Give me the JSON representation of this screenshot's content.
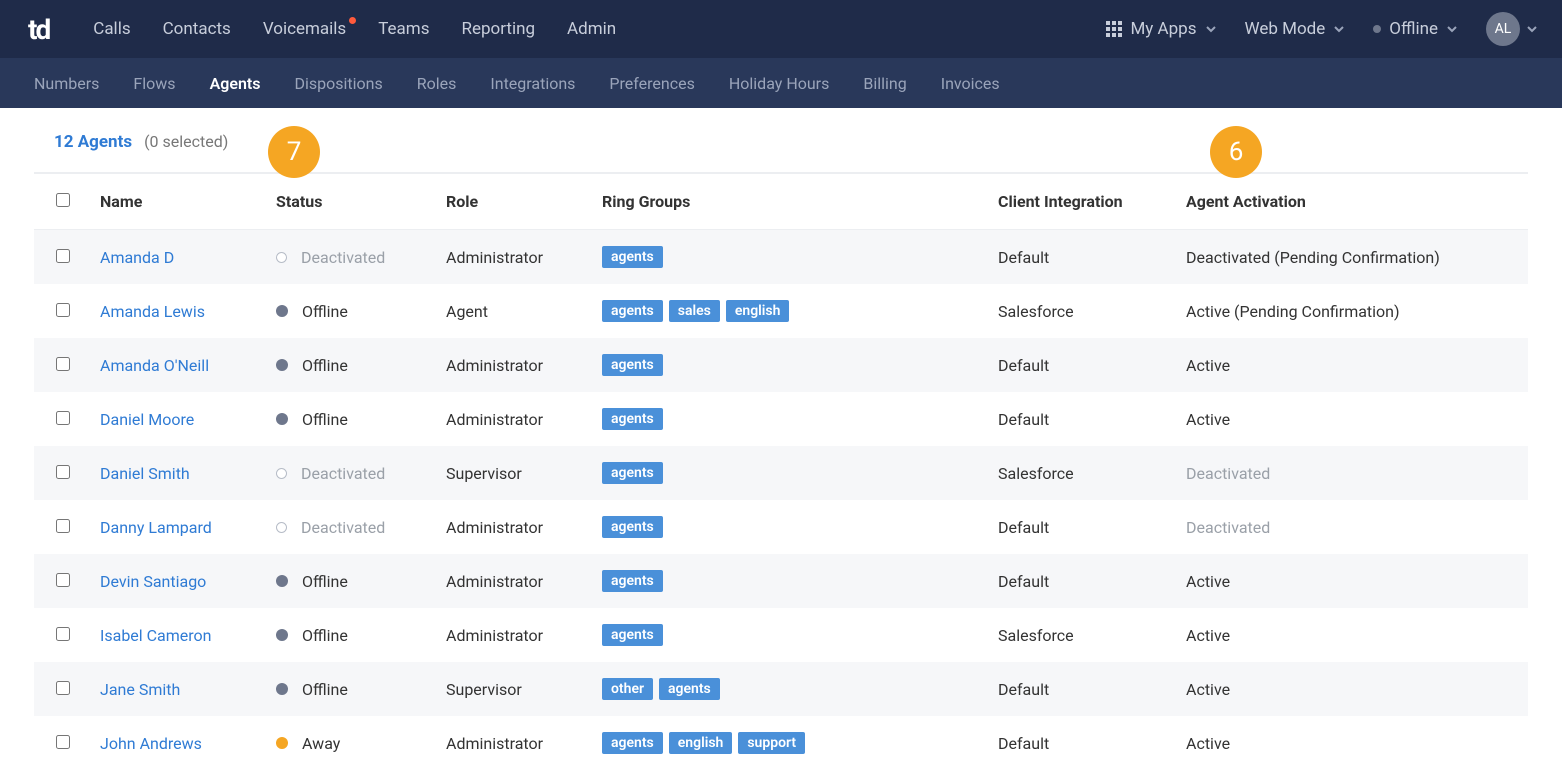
{
  "header": {
    "logo": "td",
    "nav": [
      "Calls",
      "Contacts",
      "Voicemails",
      "Teams",
      "Reporting",
      "Admin"
    ],
    "nav_notif_index": 2,
    "my_apps": "My Apps",
    "web_mode": "Web Mode",
    "presence": "Offline",
    "avatar_initials": "AL"
  },
  "subnav": {
    "items": [
      "Numbers",
      "Flows",
      "Agents",
      "Dispositions",
      "Roles",
      "Integrations",
      "Preferences",
      "Holiday Hours",
      "Billing",
      "Invoices"
    ],
    "active_index": 2
  },
  "list_header": {
    "count_text": "12 Agents",
    "selected_text": "(0 selected)"
  },
  "columns": {
    "name": "Name",
    "status": "Status",
    "role": "Role",
    "ring": "Ring Groups",
    "client": "Client Integration",
    "activation": "Agent Activation"
  },
  "badges": {
    "b7": "7",
    "b6": "6"
  },
  "rows": [
    {
      "name": "Amanda D",
      "status": "Deactivated",
      "status_kind": "deactivated",
      "role": "Administrator",
      "ring": [
        "agents"
      ],
      "client": "Default",
      "activation": "Deactivated (Pending Confirmation)",
      "act_muted": false
    },
    {
      "name": "Amanda Lewis",
      "status": "Offline",
      "status_kind": "offline",
      "role": "Agent",
      "ring": [
        "agents",
        "sales",
        "english"
      ],
      "client": "Salesforce",
      "activation": "Active (Pending Confirmation)",
      "act_muted": false
    },
    {
      "name": "Amanda O'Neill",
      "status": "Offline",
      "status_kind": "offline",
      "role": "Administrator",
      "ring": [
        "agents"
      ],
      "client": "Default",
      "activation": "Active",
      "act_muted": false
    },
    {
      "name": "Daniel Moore",
      "status": "Offline",
      "status_kind": "offline",
      "role": "Administrator",
      "ring": [
        "agents"
      ],
      "client": "Default",
      "activation": "Active",
      "act_muted": false
    },
    {
      "name": "Daniel Smith",
      "status": "Deactivated",
      "status_kind": "deactivated",
      "role": "Supervisor",
      "ring": [
        "agents"
      ],
      "client": "Salesforce",
      "activation": "Deactivated",
      "act_muted": true
    },
    {
      "name": "Danny Lampard",
      "status": "Deactivated",
      "status_kind": "deactivated",
      "role": "Administrator",
      "ring": [
        "agents"
      ],
      "client": "Default",
      "activation": "Deactivated",
      "act_muted": true
    },
    {
      "name": "Devin Santiago",
      "status": "Offline",
      "status_kind": "offline",
      "role": "Administrator",
      "ring": [
        "agents"
      ],
      "client": "Default",
      "activation": "Active",
      "act_muted": false
    },
    {
      "name": "Isabel Cameron",
      "status": "Offline",
      "status_kind": "offline",
      "role": "Administrator",
      "ring": [
        "agents"
      ],
      "client": "Salesforce",
      "activation": "Active",
      "act_muted": false
    },
    {
      "name": "Jane Smith",
      "status": "Offline",
      "status_kind": "offline",
      "role": "Supervisor",
      "ring": [
        "other",
        "agents"
      ],
      "client": "Default",
      "activation": "Active",
      "act_muted": false
    },
    {
      "name": "John Andrews",
      "status": "Away",
      "status_kind": "away",
      "role": "Administrator",
      "ring": [
        "agents",
        "english",
        "support"
      ],
      "client": "Default",
      "activation": "Active",
      "act_muted": false
    }
  ]
}
